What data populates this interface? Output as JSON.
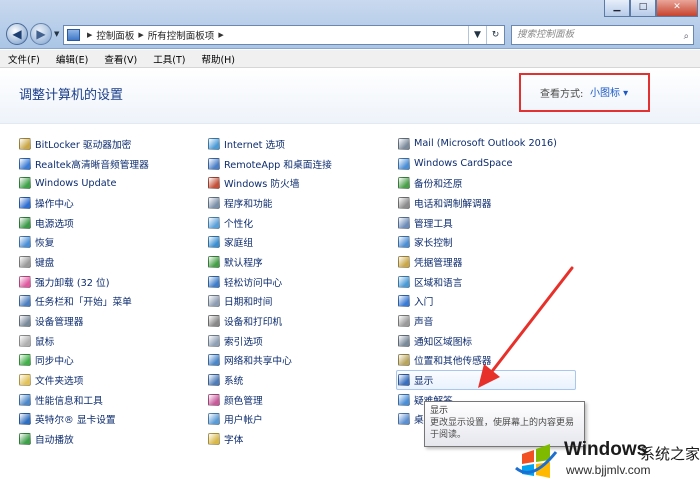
{
  "window": {
    "minimize": "▁",
    "maximize": "□",
    "close": "✕"
  },
  "address": {
    "crumbs": [
      "控制面板",
      "所有控制面板项"
    ],
    "search_placeholder": "搜索控制面板"
  },
  "menu": [
    "文件(F)",
    "编辑(E)",
    "查看(V)",
    "工具(T)",
    "帮助(H)"
  ],
  "header": {
    "title": "调整计算机的设置",
    "view_label": "查看方式:",
    "view_value": "小图标 ▾"
  },
  "columns": [
    [
      {
        "label": "BitLocker 驱动器加密",
        "icon": "bitlocker-icon",
        "color": "#c9a646"
      },
      {
        "label": "Realtek高清晰音频管理器",
        "icon": "realtek-audio-icon",
        "color": "#3a7bd5"
      },
      {
        "label": "Windows Update",
        "icon": "windows-update-icon",
        "color": "#3fa24a"
      },
      {
        "label": "操作中心",
        "icon": "action-center-flag-icon",
        "color": "#2f6fd0"
      },
      {
        "label": "电源选项",
        "icon": "power-options-icon",
        "color": "#3d9a4a"
      },
      {
        "label": "恢复",
        "icon": "recovery-icon",
        "color": "#4a8fd6"
      },
      {
        "label": "键盘",
        "icon": "keyboard-icon",
        "color": "#9a9a9a"
      },
      {
        "label": "强力卸载 (32 位)",
        "icon": "uninstall-icon",
        "color": "#e05aa0"
      },
      {
        "label": "任务栏和「开始」菜单",
        "icon": "taskbar-icon",
        "color": "#4d7fbf"
      },
      {
        "label": "设备管理器",
        "icon": "device-manager-icon",
        "color": "#7b8a99"
      },
      {
        "label": "鼠标",
        "icon": "mouse-icon",
        "color": "#b0b0b0"
      },
      {
        "label": "同步中心",
        "icon": "sync-center-icon",
        "color": "#43b04a"
      },
      {
        "label": "文件夹选项",
        "icon": "folder-options-icon",
        "color": "#e2c25a"
      },
      {
        "label": "性能信息和工具",
        "icon": "performance-icon",
        "color": "#4e88c9"
      },
      {
        "label": "英特尔® 显卡设置",
        "icon": "intel-graphics-icon",
        "color": "#2f6fc0"
      },
      {
        "label": "自动播放",
        "icon": "autoplay-icon",
        "color": "#3fa04a"
      }
    ],
    [
      {
        "label": "Internet 选项",
        "icon": "internet-options-icon",
        "color": "#4a9ad6"
      },
      {
        "label": "RemoteApp 和桌面连接",
        "icon": "remoteapp-icon",
        "color": "#4a7fc8"
      },
      {
        "label": "Windows 防火墙",
        "icon": "firewall-icon",
        "color": "#c4503a"
      },
      {
        "label": "程序和功能",
        "icon": "programs-icon",
        "color": "#7a8fa8"
      },
      {
        "label": "个性化",
        "icon": "personalization-icon",
        "color": "#5aa0d8"
      },
      {
        "label": "家庭组",
        "icon": "homegroup-icon",
        "color": "#3b8fd0"
      },
      {
        "label": "默认程序",
        "icon": "default-programs-icon",
        "color": "#45a047"
      },
      {
        "label": "轻松访问中心",
        "icon": "ease-of-access-icon",
        "color": "#3d7dc9"
      },
      {
        "label": "日期和时间",
        "icon": "clock-icon",
        "color": "#8d9cb0"
      },
      {
        "label": "设备和打印机",
        "icon": "printer-icon",
        "color": "#888888"
      },
      {
        "label": "索引选项",
        "icon": "indexing-icon",
        "color": "#8fa0b4"
      },
      {
        "label": "网络和共享中心",
        "icon": "network-icon",
        "color": "#4a86c8"
      },
      {
        "label": "系统",
        "icon": "system-icon",
        "color": "#4e7cb8"
      },
      {
        "label": "颜色管理",
        "icon": "color-management-icon",
        "color": "#c85a9a"
      },
      {
        "label": "用户帐户",
        "icon": "user-accounts-icon",
        "color": "#5a9bd5"
      },
      {
        "label": "字体",
        "icon": "fonts-icon",
        "color": "#d9b84a"
      }
    ],
    [
      {
        "label": "Mail (Microsoft Outlook 2016)",
        "icon": "mail-icon",
        "color": "#7a8a9a"
      },
      {
        "label": "Windows CardSpace",
        "icon": "cardspace-icon",
        "color": "#4a8fd6"
      },
      {
        "label": "备份和还原",
        "icon": "backup-icon",
        "color": "#4aa04a"
      },
      {
        "label": "电话和调制解调器",
        "icon": "phone-modem-icon",
        "color": "#8b8b8b"
      },
      {
        "label": "管理工具",
        "icon": "admin-tools-icon",
        "color": "#6d8db8"
      },
      {
        "label": "家长控制",
        "icon": "parental-controls-icon",
        "color": "#4b8ed3"
      },
      {
        "label": "凭据管理器",
        "icon": "credential-manager-icon",
        "color": "#c9a646"
      },
      {
        "label": "区域和语言",
        "icon": "region-language-icon",
        "color": "#4a9ad6"
      },
      {
        "label": "入门",
        "icon": "getting-started-icon",
        "color": "#3a7bd5"
      },
      {
        "label": "声音",
        "icon": "sound-icon",
        "color": "#9a9a9a"
      },
      {
        "label": "通知区域图标",
        "icon": "notification-icons-icon",
        "color": "#7a8a99"
      },
      {
        "label": "位置和其他传感器",
        "icon": "sensors-icon",
        "color": "#b8a45a"
      },
      {
        "label": "显示",
        "icon": "display-icon",
        "color": "#3a6fc0"
      },
      {
        "label": "疑难解答",
        "icon": "troubleshooting-icon",
        "color": "#4a8fd6"
      },
      {
        "label": "桌面小工具",
        "icon": "gadgets-icon",
        "color": "#5b8fd0"
      }
    ]
  ],
  "tooltip": {
    "title": "显示",
    "text": "更改显示设置，使屏幕上的内容更易于阅读。"
  },
  "watermark": {
    "brand": "Windows",
    "suffix": "系统之家",
    "url": "www.bjjmlv.com"
  }
}
